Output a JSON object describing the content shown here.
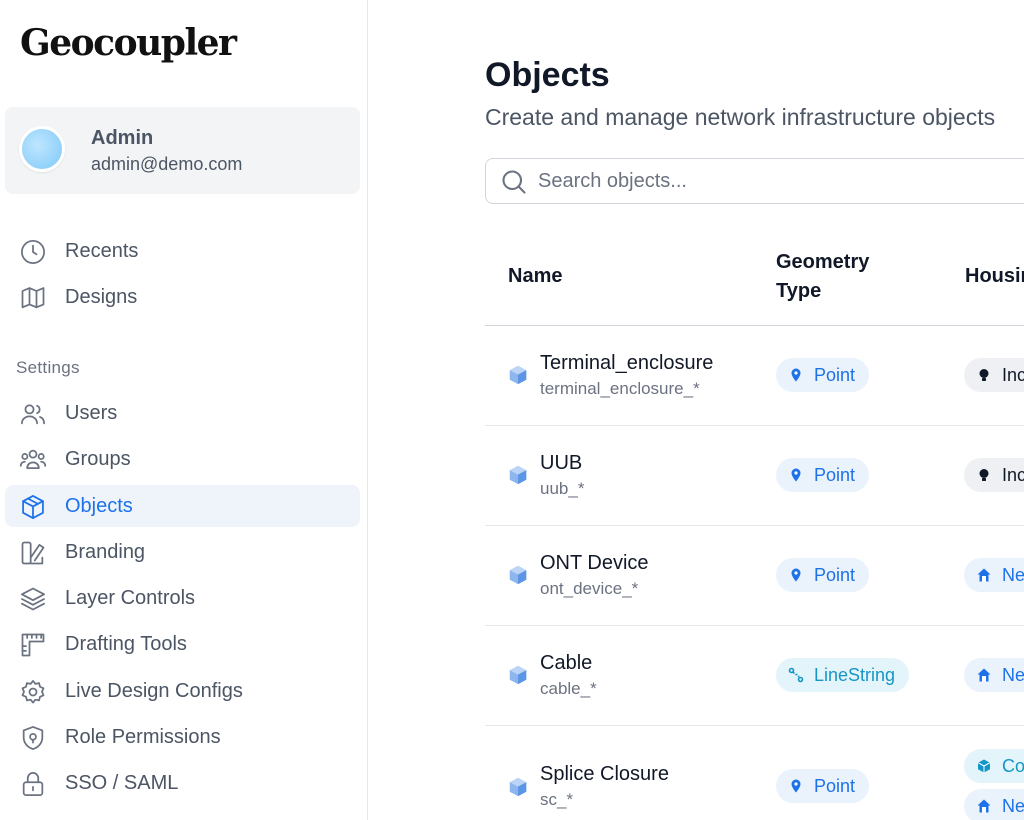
{
  "app": {
    "logo": "Geocoupler"
  },
  "user": {
    "name": "Admin",
    "email": "admin@demo.com"
  },
  "sidebar": {
    "top_items": [
      {
        "label": "Recents",
        "icon": "clock-icon"
      },
      {
        "label": "Designs",
        "icon": "map-icon"
      }
    ],
    "section_label": "Settings",
    "settings_items": [
      {
        "label": "Users",
        "icon": "users-icon"
      },
      {
        "label": "Groups",
        "icon": "groups-icon"
      },
      {
        "label": "Objects",
        "icon": "cube-icon",
        "active": true
      },
      {
        "label": "Branding",
        "icon": "palette-icon"
      },
      {
        "label": "Layer Controls",
        "icon": "layers-icon"
      },
      {
        "label": "Drafting Tools",
        "icon": "ruler-icon"
      },
      {
        "label": "Live Design Configs",
        "icon": "gear-icon"
      },
      {
        "label": "Role Permissions",
        "icon": "shield-icon"
      },
      {
        "label": "SSO / SAML",
        "icon": "lock-icon"
      }
    ]
  },
  "main": {
    "title": "Objects",
    "subtitle": "Create and manage network infrastructure objects",
    "search": {
      "placeholder": "Search objects..."
    },
    "table": {
      "headers": {
        "name": "Name",
        "geometry_line1": "Geometry",
        "geometry_line2": "Type",
        "housing": "Housing"
      },
      "rows": [
        {
          "name": "Terminal_enclosure",
          "key": "terminal_enclosure_*",
          "geometry": "Point",
          "housing": [
            "Inc"
          ]
        },
        {
          "name": "UUB",
          "key": "uub_*",
          "geometry": "Point",
          "housing": [
            "Inc"
          ]
        },
        {
          "name": "ONT Device",
          "key": "ont_device_*",
          "geometry": "Point",
          "housing": [
            "Ne"
          ]
        },
        {
          "name": "Cable",
          "key": "cable_*",
          "geometry": "LineString",
          "housing": [
            "Ne"
          ]
        },
        {
          "name": "Splice Closure",
          "key": "sc_*",
          "geometry": "Point",
          "housing": [
            "Co",
            "Ne"
          ]
        }
      ]
    }
  },
  "colors": {
    "accent": "#1d72e8",
    "active_bg": "#eff4fb",
    "linestring": "#1696c6"
  }
}
